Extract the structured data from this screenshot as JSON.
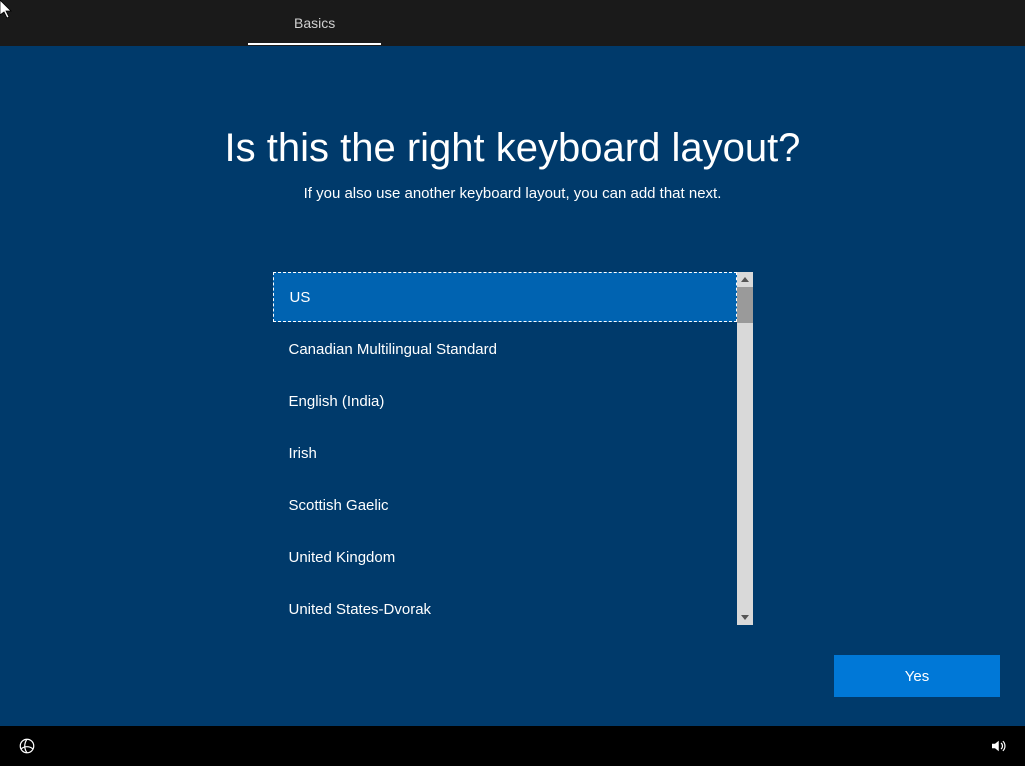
{
  "header": {
    "active_tab": "Basics"
  },
  "main": {
    "title": "Is this the right keyboard layout?",
    "subtitle": "If you also use another keyboard layout, you can add that next.",
    "layouts": [
      "US",
      "Canadian Multilingual Standard",
      "English (India)",
      "Irish",
      "Scottish Gaelic",
      "United Kingdom",
      "United States-Dvorak"
    ],
    "selected_index": 0,
    "yes_button": "Yes"
  },
  "icons": {
    "power": "power-icon",
    "volume": "volume-icon"
  }
}
